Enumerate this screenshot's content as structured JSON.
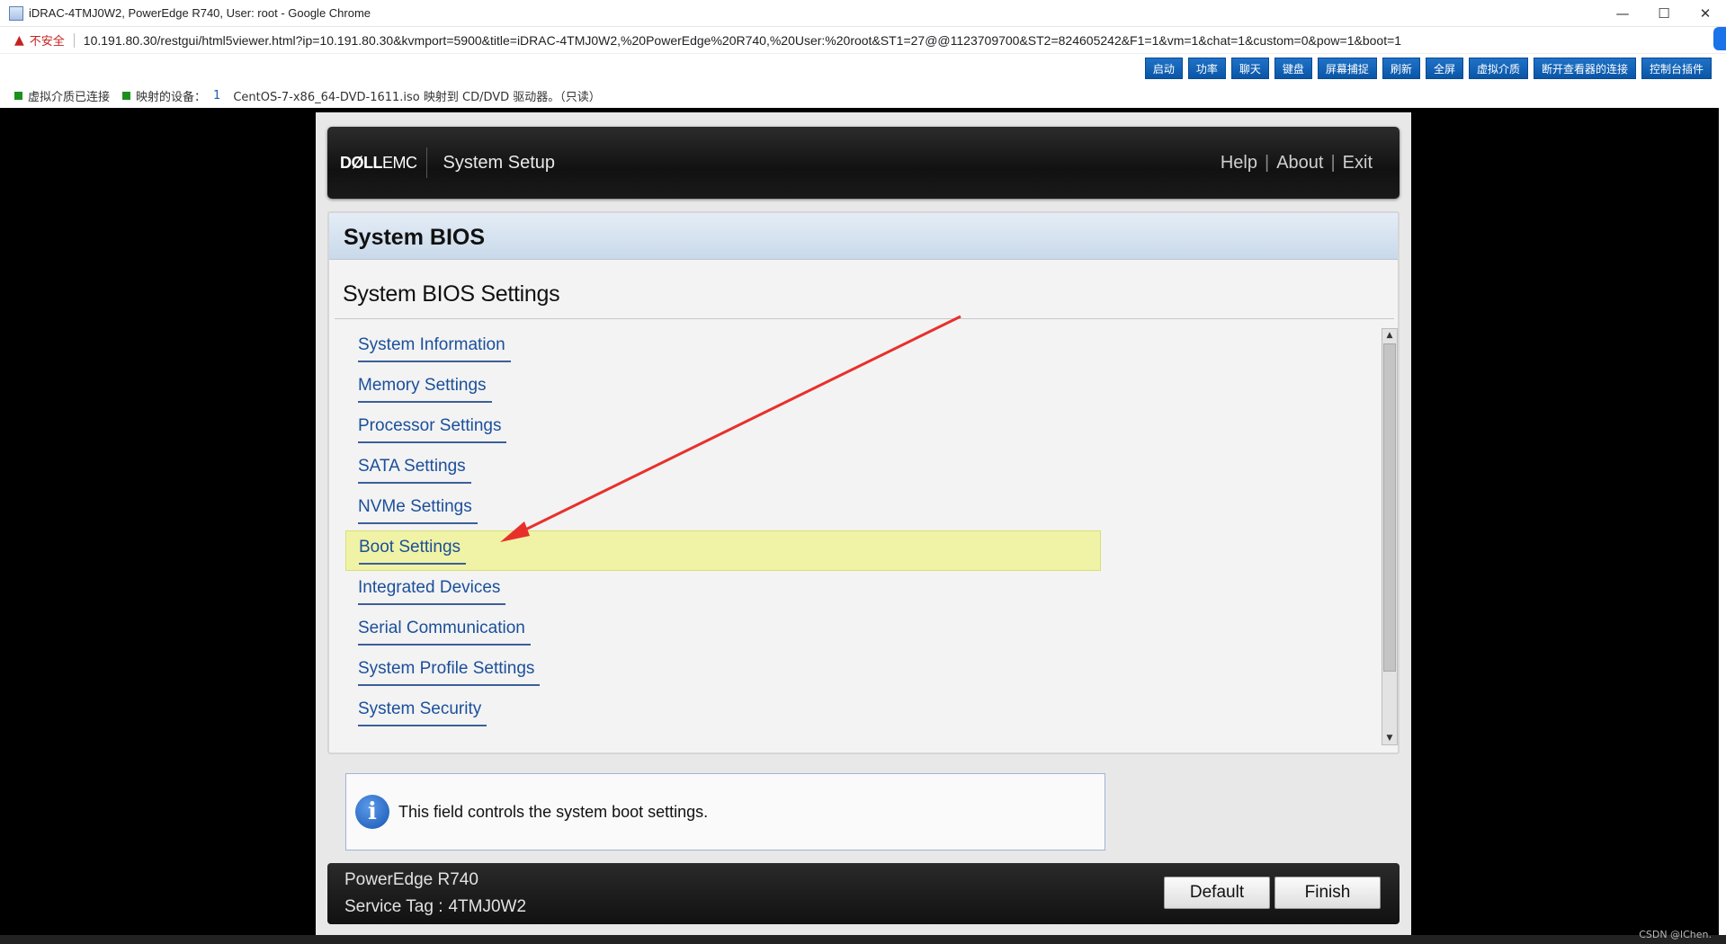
{
  "browser": {
    "window_title": "iDRAC-4TMJ0W2, PowerEdge R740, User: root - Google Chrome",
    "insecure_label": "不安全",
    "url": "10.191.80.30/restgui/html5viewer.html?ip=10.191.80.30&kvmport=5900&title=iDRAC-4TMJ0W2,%20PowerEdge%20R740,%20User:%20root&ST1=27@@1123709700&ST2=824605242&F1=1&vm=1&chat=1&custom=0&pow=1&boot=1",
    "minimize": "—",
    "maximize": "☐",
    "close": "✕"
  },
  "viewer": {
    "toolbar": [
      "启动",
      "功率",
      "聊天",
      "键盘",
      "屏幕捕捉",
      "刷新",
      "全屏",
      "虚拟介质",
      "断开查看器的连接",
      "控制台插件"
    ],
    "status": {
      "vmedia_connected": "虚拟介质已连接",
      "mapped_devices_label": "映射的设备：",
      "mapped_devices_count": "1",
      "mapped_detail": "CentOS-7-x86_64-DVD-1611.iso 映射到 CD/DVD 驱动器。（只读）"
    }
  },
  "bios": {
    "brand_dell": "DØLL",
    "brand_emc": "EMC",
    "app_title": "System Setup",
    "links": {
      "help": "Help",
      "about": "About",
      "exit": "Exit",
      "sep": "|"
    },
    "panel_title": "System BIOS",
    "section_title": "System BIOS Settings",
    "menu": [
      "System Information",
      "Memory Settings",
      "Processor Settings",
      "SATA Settings",
      "NVMe Settings",
      "Boot Settings",
      "Integrated Devices",
      "Serial Communication",
      "System Profile Settings",
      "System Security"
    ],
    "selected_item": "Boot Settings",
    "help_text": "This field controls the system boot settings.",
    "model": "PowerEdge R740",
    "service_tag_label": "Service Tag :",
    "service_tag": "4TMJ0W2",
    "default_button": "Default",
    "finish_button": "Finish"
  },
  "watermark": "CSDN @lChen.",
  "colors": {
    "link_blue": "#1b4f9a",
    "selected_bg": "#f0f3a5",
    "toolbar_blue": "#0a56a7",
    "arrow_red": "#e8302b"
  }
}
